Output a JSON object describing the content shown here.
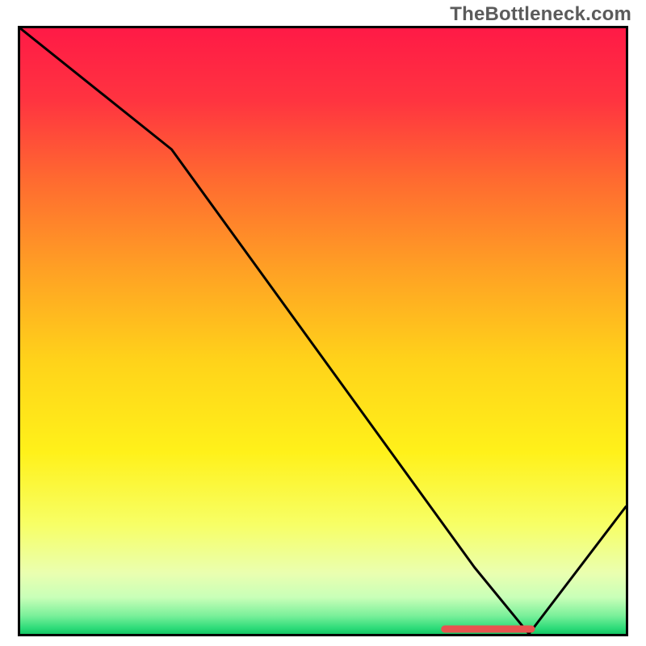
{
  "watermark": "TheBottleneck.com",
  "chart_data": {
    "type": "line",
    "title": "",
    "xlabel": "",
    "ylabel": "",
    "xlim": [
      0,
      100
    ],
    "ylim": [
      0,
      100
    ],
    "x": [
      0,
      25,
      75,
      84,
      100
    ],
    "values": [
      100,
      80,
      11,
      0,
      21
    ],
    "optimum_range_x": [
      69.5,
      85.0
    ],
    "gradient_stops": [
      {
        "pct": 0,
        "color": "#ff1a46"
      },
      {
        "pct": 12,
        "color": "#ff3440"
      },
      {
        "pct": 25,
        "color": "#ff6a30"
      },
      {
        "pct": 40,
        "color": "#ffa124"
      },
      {
        "pct": 55,
        "color": "#ffd31a"
      },
      {
        "pct": 70,
        "color": "#fff11a"
      },
      {
        "pct": 82,
        "color": "#f7ff66"
      },
      {
        "pct": 90,
        "color": "#eaffb0"
      },
      {
        "pct": 94,
        "color": "#c8ffb8"
      },
      {
        "pct": 97,
        "color": "#7af09a"
      },
      {
        "pct": 99,
        "color": "#2fdc7a"
      },
      {
        "pct": 100,
        "color": "#14c765"
      }
    ],
    "marker_color": "#e8534f"
  }
}
